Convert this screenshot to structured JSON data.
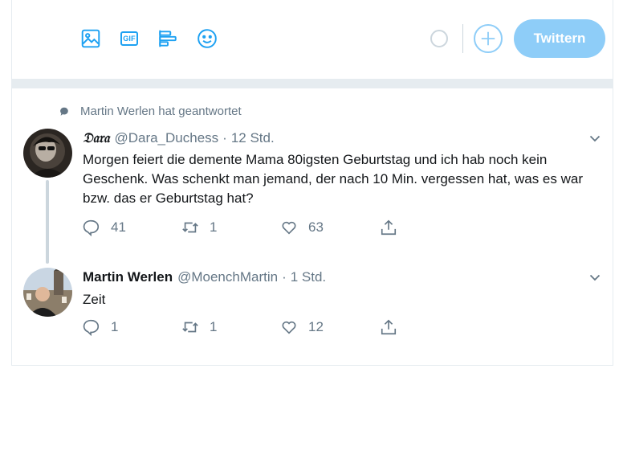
{
  "composer": {
    "tools": [
      "image-icon",
      "gif-icon",
      "poll-icon",
      "emoji-icon"
    ],
    "gif_label": "GIF",
    "tweet_button_label": "Twittern"
  },
  "thread": {
    "context_label": "Martin Werlen hat geantwortet",
    "original": {
      "display_name": "𝔇𝔞𝔯𝔞",
      "handle": "@Dara_Duchess",
      "separator": "·",
      "time": "12 Std.",
      "text": "Morgen feiert die demente Mama 80igsten Geburtstag und ich hab noch kein Geschenk. Was schenkt man jemand, der nach 10 Min. vergessen hat, was es war bzw. das er Geburtstag hat?",
      "replies": "41",
      "retweets": "1",
      "likes": "63"
    },
    "reply": {
      "display_name": "Martin Werlen",
      "handle": "@MoenchMartin",
      "separator": "·",
      "time": "1 Std.",
      "text": "Zeit",
      "replies": "1",
      "retweets": "1",
      "likes": "12"
    }
  },
  "colors": {
    "accent": "#1da1f2",
    "accent_disabled": "#8ecdf8",
    "muted": "#657786",
    "divider": "#e6ecf0"
  }
}
